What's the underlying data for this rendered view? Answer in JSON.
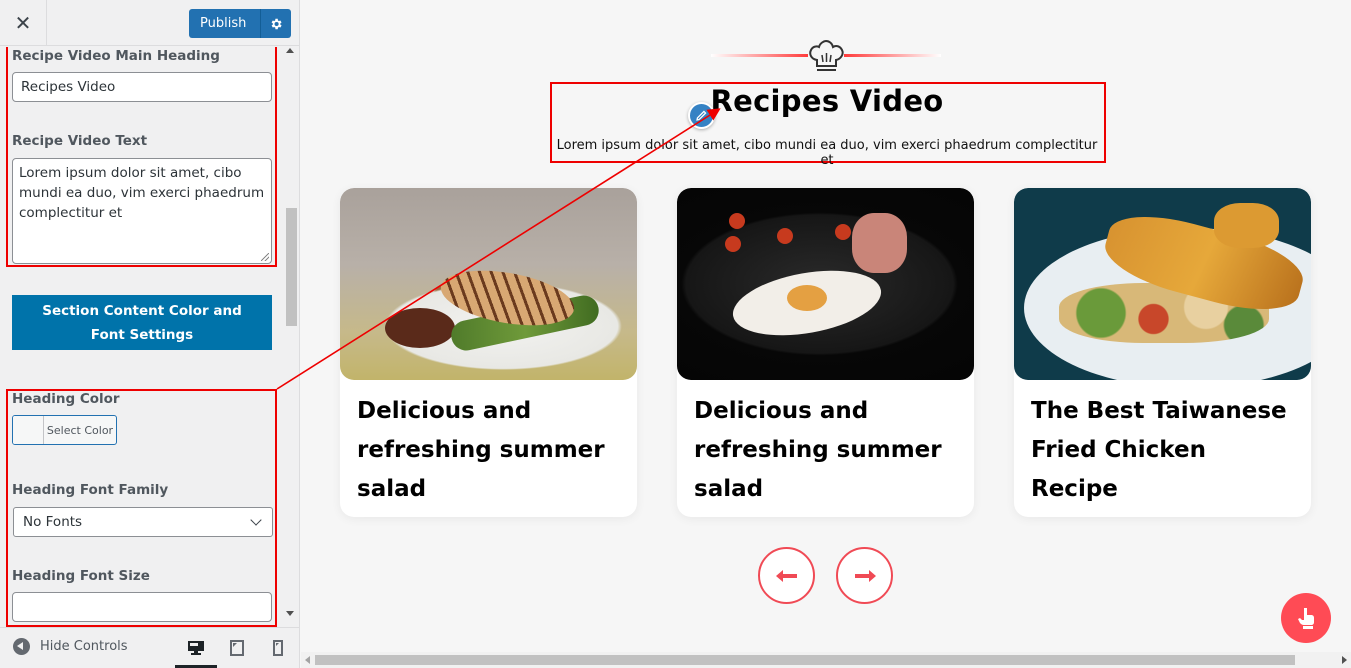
{
  "sidebar": {
    "header": {
      "close_label": "✕",
      "publish_label": "Publish",
      "settings_icon": "gear-icon"
    },
    "controls": {
      "main_heading": {
        "label": "Recipe Video Main Heading",
        "value": "Recipes Video"
      },
      "video_text": {
        "label": "Recipe Video Text",
        "value": "Lorem ipsum dolor sit amet, cibo mundi ea duo, vim exerci phaedrum complectitur et"
      },
      "section_button": {
        "label": "Section Content Color and Font Settings"
      },
      "heading_color": {
        "label": "Heading Color",
        "button_label": "Select Color"
      },
      "heading_font_family": {
        "label": "Heading Font Family",
        "selected": "No Fonts"
      },
      "heading_font_size": {
        "label": "Heading Font Size",
        "value": ""
      }
    },
    "footer": {
      "hide_controls_label": "Hide Controls",
      "devices": [
        {
          "name": "desktop",
          "active": true
        },
        {
          "name": "tablet",
          "active": false
        },
        {
          "name": "mobile",
          "active": false
        }
      ]
    }
  },
  "preview": {
    "section": {
      "icon": "chef-hat-icon",
      "title": "Recipes Video",
      "text": "Lorem ipsum dolor sit amet, cibo mundi ea duo, vim exerci phaedrum complectitur et"
    },
    "cards": [
      {
        "title": "Delicious and refreshing summer salad",
        "image": "grilled-chicken-asparagus-plate"
      },
      {
        "title": "Delicious and refreshing summer salad",
        "image": "dark-plate-egg-tomatoes"
      },
      {
        "title": "The Best Taiwanese Fried Chicken Recipe",
        "image": "chicken-skewers-vegetables-plate"
      }
    ],
    "nav": {
      "prev_icon": "arrow-left-icon",
      "next_icon": "arrow-right-icon"
    },
    "fab_icon": "hand-pointer-icon"
  },
  "colors": {
    "accent_red": "#f04a55",
    "publish_blue": "#2271b1",
    "section_button_blue": "#0073aa",
    "annotation_red": "#ee0000"
  }
}
